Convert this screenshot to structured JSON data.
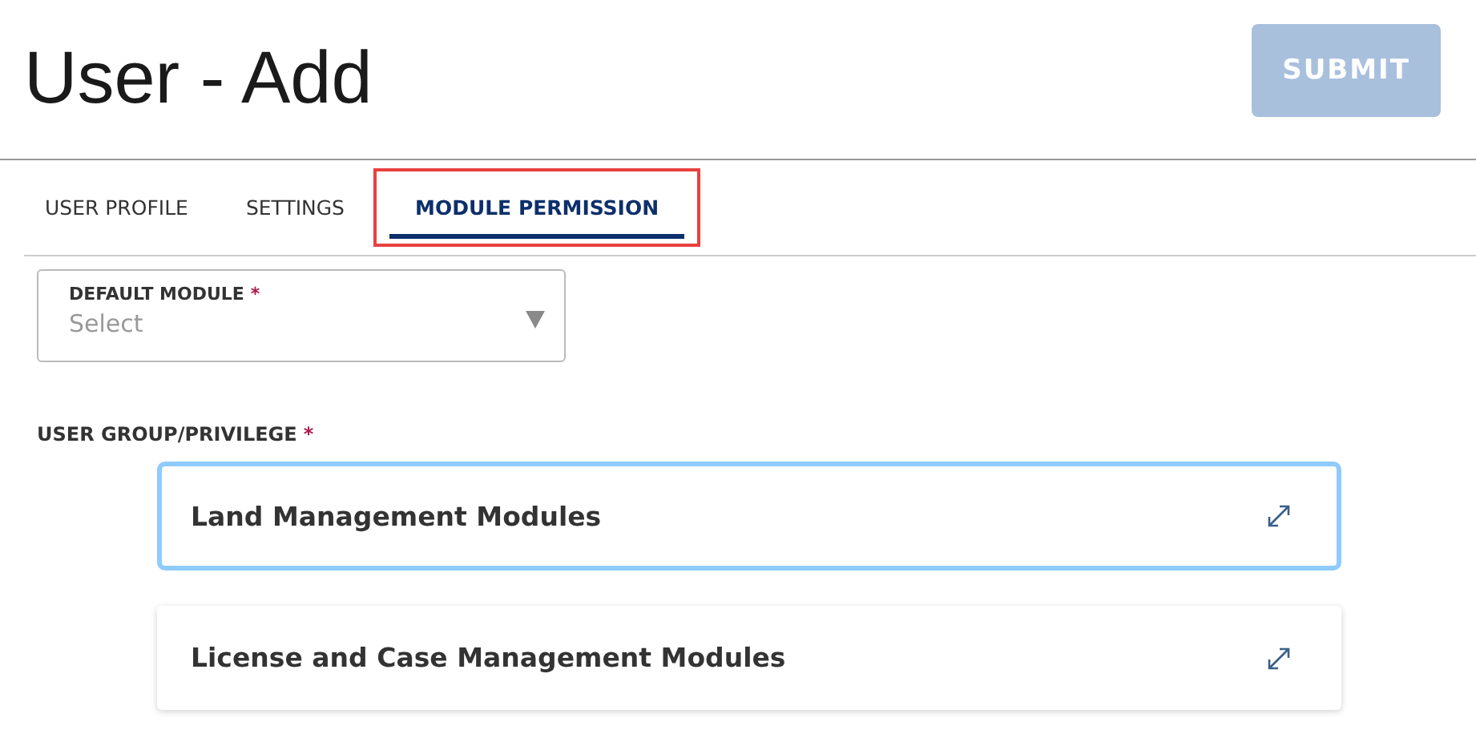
{
  "page": {
    "title": "User - Add"
  },
  "submit_button": {
    "label": "SUBMIT",
    "disabled": true
  },
  "tabs": [
    {
      "label": "USER PROFILE",
      "selected": false,
      "highlighted": false
    },
    {
      "label": "SETTINGS",
      "selected": false,
      "highlighted": false
    },
    {
      "label": "MODULE PERMISSION",
      "selected": true,
      "highlighted": true
    }
  ],
  "default_module": {
    "label": "DEFAULT MODULE",
    "required_mark": "*",
    "placeholder": "Select"
  },
  "user_group": {
    "label": "USER GROUP/PRIVILEGE",
    "required_mark": "*",
    "panels": [
      {
        "title": "Land Management Modules",
        "focused": true
      },
      {
        "title": "License and Case Management Modules",
        "focused": false
      }
    ]
  }
}
